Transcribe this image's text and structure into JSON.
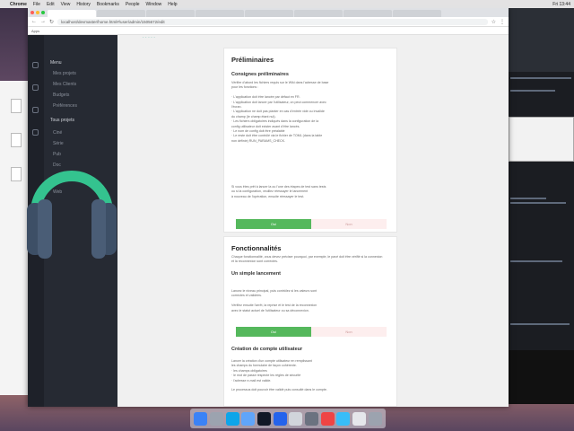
{
  "menubar": {
    "app": "Chrome",
    "items": [
      "File",
      "Edit",
      "View",
      "History",
      "Bookmarks",
      "People",
      "Window",
      "Help"
    ],
    "right_clock": "Fri 13:44"
  },
  "browser": {
    "tabs": [
      "",
      "",
      "",
      "",
      "",
      "",
      "",
      ""
    ],
    "url": "localhost/devmaster/home.html#/user/admin/1505672/edit",
    "bookmarks": [
      "Apps",
      "",
      "",
      "",
      "",
      "",
      "",
      "",
      ""
    ]
  },
  "top_fragment": "· · · · ·",
  "sidebar": {
    "section_menu": "Menu",
    "menu_items": [
      "Mes projets",
      "Mes Clients",
      "Budgets",
      "Préférences"
    ],
    "section_projects": "Tous projets",
    "project_items": [
      "Ciné",
      "Série",
      "Pub",
      "Doc",
      "Clip",
      "Web"
    ]
  },
  "page": {
    "title": "Préliminaires",
    "section1_title": "Consignes préliminaires",
    "section1_lines": [
      "Vérifier d'abord les fichiers requis sur le Wiki dans l'adresse de base",
      "pour les fonctions :",
      "",
      "· L'application doit être lancée par défaut en FR.",
      "· L'application doit lancer par l'utilisateur, on peut commencer avec",
      "l'écran.",
      "· L'application ne doit pas planter en cas d'entrée vide ou invalide",
      "du champ (le champ étant nul).",
      "· Les fichiers obligatoires indiqués dans la configuration de la",
      "config utilisateur doit exister avant d'être lancés.",
      "· Le nom de config doit être préalable",
      "· Le reste doit être contrôlé via le fichier de TOML (dans la table",
      "non définie) RUN_PARAMS_CHECK."
    ],
    "section1_lines2": [
      "Si vous êtes prêt à lancer la ou l'une des étapes de test sans tests",
      "ou si la configuration, veuillez réessayer le lancement",
      "à nouveau de l'opération, ensuite réessayer le test."
    ],
    "btn_yes": "Oui",
    "btn_no": "Non",
    "section2_heading": "Fonctionnalités",
    "section2_intro": [
      "Chaque fonctionnalité, vous devez préciser pourquoi, par exemple, le pavé doit être vérifié si la connexion",
      "et la reconnexion sont correctes."
    ],
    "section2_sub": "Un simple lancement",
    "section2_lines": [
      "Lancez le niveau principal, puis contrôlez si les valeurs sont",
      "correctes et validées.",
      "",
      "Vérifiez ensuite l'arrêt, la reprise et le test de la reconnexion",
      "avec le statut actuel de l'utilisateur ou sa déconnexion."
    ],
    "section3_sub": "Création de compte utilisateur",
    "section3_lines": [
      "Lancer la création d'un compte utilisateur en remplissant",
      "les champs du formulaire de façon cohérente.",
      "· les champs obligatoires",
      "· le mot de passe respecte les règles de sécurité",
      "· l'adresse e-mail est valide.",
      "",
      "Le processus doit pouvoir être validé puis consulté dans le compte."
    ]
  },
  "dock_icons": [
    "finder-icon",
    "launchpad-icon",
    "safari-icon",
    "mail-icon",
    "terminal-icon",
    "vscode-icon",
    "preview-icon",
    "photos-icon",
    "chrome-icon",
    "app-store-icon",
    "settings-icon",
    "notes-icon",
    "trash-icon"
  ],
  "colors": {
    "green": "#55b85c",
    "sidebar": "#262a33",
    "headphones_teal": "#34c38f",
    "headphones_gray": "#3d4f66"
  }
}
